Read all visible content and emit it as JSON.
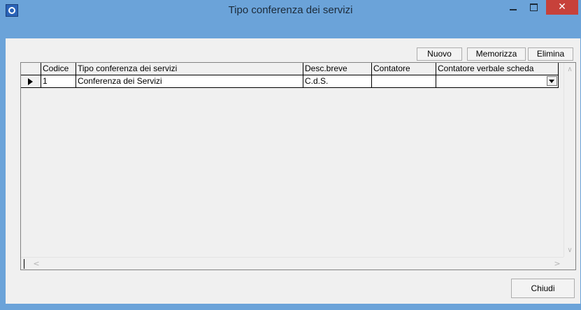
{
  "window": {
    "title": "Tipo conferenza dei servizi",
    "app_icon": "app-logo-icon"
  },
  "toolbar": {
    "new_label": "Nuovo",
    "save_label": "Memorizza",
    "delete_label": "Elimina"
  },
  "grid": {
    "columns": [
      "Codice",
      "Tipo conferenza dei servizi",
      "Desc.breve",
      "Contatore",
      "Contatore verbale scheda"
    ],
    "rows": [
      {
        "codice": "1",
        "tipo": "Conferenza dei Servizi",
        "desc_breve": "C.d.S.",
        "contatore": "",
        "contatore_verbale": ""
      }
    ]
  },
  "footer": {
    "close_label": "Chiudi"
  },
  "colors": {
    "frame": "#6ba3d9",
    "close_button": "#c7413a",
    "client": "#f0f0f0"
  }
}
